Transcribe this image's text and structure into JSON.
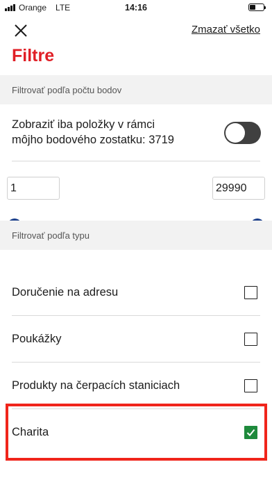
{
  "status_bar": {
    "carrier": "Orange",
    "network": "LTE",
    "time": "14:16"
  },
  "header": {
    "clear_all_label": "Zmazať všetko",
    "title": "Filtre"
  },
  "points_section": {
    "header": "Filtrovať podľa počtu bodov",
    "toggle_label_line1": "Zobraziť iba položky v rámci",
    "toggle_label_line2": "môjho bodového zostatku: 3719",
    "toggle_on": false,
    "range_min": "1",
    "range_max": "29990"
  },
  "type_section": {
    "header": "Filtrovať podľa typu",
    "items": [
      {
        "label": "Doručenie na adresu",
        "checked": false
      },
      {
        "label": "Poukážky",
        "checked": false
      },
      {
        "label": "Produkty na čerpacích staniciach",
        "checked": false
      },
      {
        "label": "Charita",
        "checked": true
      }
    ]
  },
  "colors": {
    "brand_red": "#e01f26",
    "slider_blue": "#1b3f8b",
    "check_green": "#1e8a3c",
    "highlight_red": "#f0251b"
  }
}
